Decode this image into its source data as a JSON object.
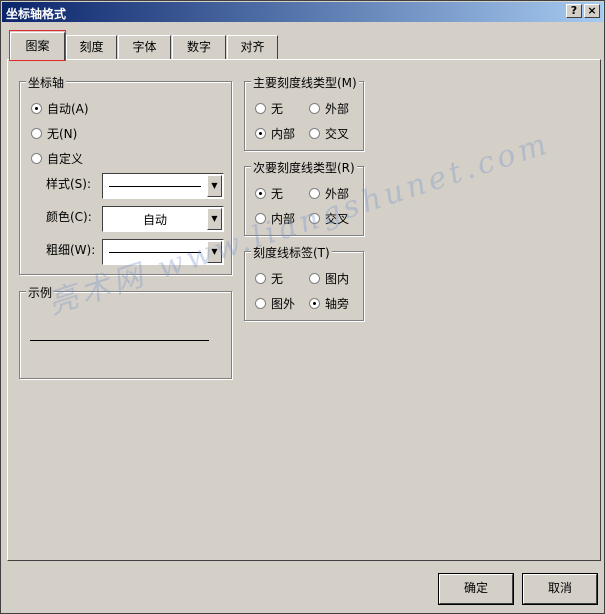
{
  "window": {
    "title": "坐标轴格式",
    "help_label": "?",
    "close_label": "×"
  },
  "tabs": [
    {
      "label": "图案"
    },
    {
      "label": "刻度"
    },
    {
      "label": "字体"
    },
    {
      "label": "数字"
    },
    {
      "label": "对齐"
    }
  ],
  "axis_group": {
    "title": "坐标轴",
    "options": [
      "自动(A)",
      "无(N)",
      "自定义"
    ],
    "selected": 0,
    "style_label": "样式(S):",
    "color_label": "颜色(C):",
    "color_value": "自动",
    "weight_label": "粗细(W):"
  },
  "sample_group": {
    "title": "示例"
  },
  "major_tick": {
    "title": "主要刻度线类型(M)",
    "options": [
      "无",
      "外部",
      "内部",
      "交叉"
    ],
    "selected": 2
  },
  "minor_tick": {
    "title": "次要刻度线类型(R)",
    "options": [
      "无",
      "外部",
      "内部",
      "交叉"
    ],
    "selected": 0
  },
  "tick_labels": {
    "title": "刻度线标签(T)",
    "options": [
      "无",
      "图内",
      "图外",
      "轴旁"
    ],
    "selected": 3
  },
  "buttons": {
    "ok": "确定",
    "cancel": "取消"
  },
  "watermark": "亮术网 www.liangshunet.com"
}
